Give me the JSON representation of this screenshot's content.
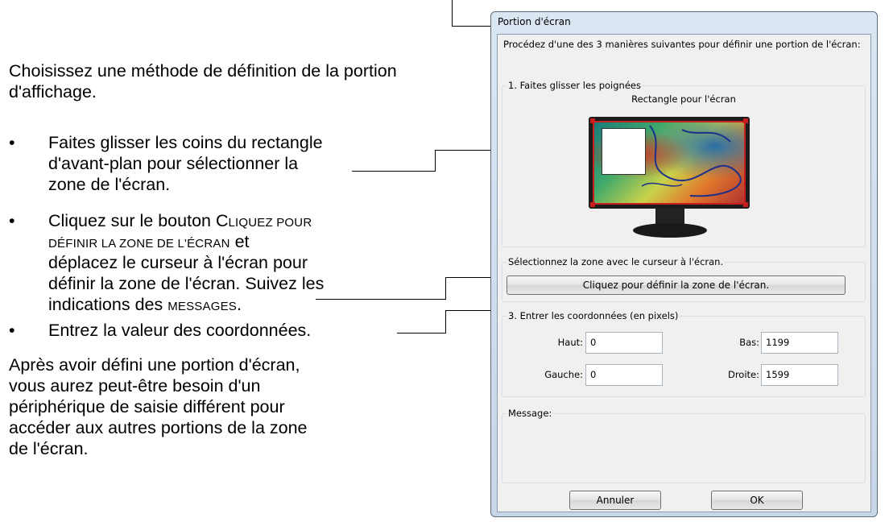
{
  "doc": {
    "intro": "Choisissez une méthode de définition de la portion d'affichage.",
    "bullet": "•",
    "bullet1": [
      "Faites glisser les coins du rectangle",
      "d'avant-plan pour sélectionner la",
      "zone de l'écran."
    ],
    "bullet2": {
      "line1_pre": "Cliquez sur le bouton C",
      "line1_sc": "LIQUEZ POUR",
      "line2_sc": "DÉFINIR LA ZONE DE L'ÉCRAN",
      "line2_post": " et",
      "line3": "déplacez le curseur à l'écran pour",
      "line4": "définir la zone de l'écran. Suivez les",
      "line5_pre": "indications des ",
      "line5_sc": "MESSAGES",
      "line5_post": "."
    },
    "bullet3": "Entrez la valeur des coordonnées.",
    "outro": [
      "Après avoir défini une portion d'écran,",
      "vous aurez peut-être besoin d'un",
      "périphérique de saisie différent pour",
      "accéder aux autres portions de la zone",
      "de l'écran."
    ]
  },
  "dialog": {
    "title": "Portion d'écran",
    "prompt": "Procédez d'une des 3 manières suivantes pour définir une portion de l'écran:",
    "group1_label": "1. Faites glisser les poignées",
    "rect_label": "Rectangle pour l'écran",
    "group2_label": "Sélectionnez la zone avec le curseur à l'écran.",
    "define_button": "Cliquez pour définir la zone de l'écran.",
    "group3_label": "3. Entrer les coordonnées (en pixels)",
    "fields": {
      "haut_label": "Haut:",
      "haut_value": "0",
      "bas_label": "Bas:",
      "bas_value": "1199",
      "gauche_label": "Gauche:",
      "gauche_value": "0",
      "droite_label": "Droite:",
      "droite_value": "1599"
    },
    "message_label": "Message:",
    "cancel_button": "Annuler",
    "ok_button": "OK"
  }
}
